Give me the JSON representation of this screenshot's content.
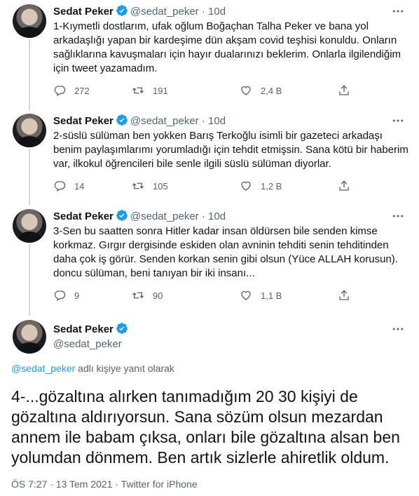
{
  "tweets": [
    {
      "name": "Sedat Peker",
      "handle": "@sedat_peker",
      "dot": "·",
      "time": "10d",
      "text": "1-Kıymetli dostlarım, ufak oğlum Boğaçhan Talha Peker ve bana yol arkadaşlığı yapan bir kardeşime dün akşam covid teşhisi konuldu. Onların sağlıklarına kavuşmaları için hayır dualarınızı beklerim. Onlarla ilgilendiğim için tweet yazamadım.",
      "replies": "272",
      "retweets": "191",
      "likes": "2,4 B"
    },
    {
      "name": "Sedat Peker",
      "handle": "@sedat_peker",
      "dot": "·",
      "time": "10d",
      "text": "2-süslü sülüman ben yokken Barış Terkoğlu isimli bir gazeteci arkadaşı benim paylaşımlarımı yorumladığı için tehdit etmişsin. Sana kötü bir haberim var, ilkokul öğrencileri bile senle ilgili süslü sülüman diyorlar.",
      "replies": "14",
      "retweets": "105",
      "likes": "1,2 B"
    },
    {
      "name": "Sedat Peker",
      "handle": "@sedat_peker",
      "dot": "·",
      "time": "10d",
      "text": "3-Sen bu saatten sonra Hitler kadar insan öldürsen bile senden kimse korkmaz. Gırgır dergisinde eskiden olan avninin tehditi senin tehditinden daha çok iş görür. Senden korkan senin gibi olsun (Yüce ALLAH korusun). doncu sülüman, beni tanıyan bir iki insanı...",
      "replies": "9",
      "retweets": "90",
      "likes": "1,1 B"
    }
  ],
  "focal": {
    "name": "Sedat Peker",
    "handle": "@sedat_peker",
    "reply_to_handle": "@sedat_peker",
    "reply_to_suffix": " adlı kişiye yanıt olarak",
    "text": "4-...gözaltına alırken tanımadığım 20 30 kişiyi de gözaltına aldırıyorsun. Sana sözüm olsun mezardan annem ile babam çıksa, onları bile gözaltına alsan ben yolumdan dönmem. Ben artık sizlerle ahiretlik oldum.",
    "meta": "ÖS 7:27 · 13 Tem 2021 · Twitter for iPhone"
  },
  "icons": [
    "verified-badge-icon",
    "more-icon",
    "reply-icon",
    "retweet-icon",
    "like-icon",
    "share-icon"
  ],
  "colors": {
    "accent": "#1d9bf0",
    "muted": "#536471",
    "text": "#0f1419"
  }
}
